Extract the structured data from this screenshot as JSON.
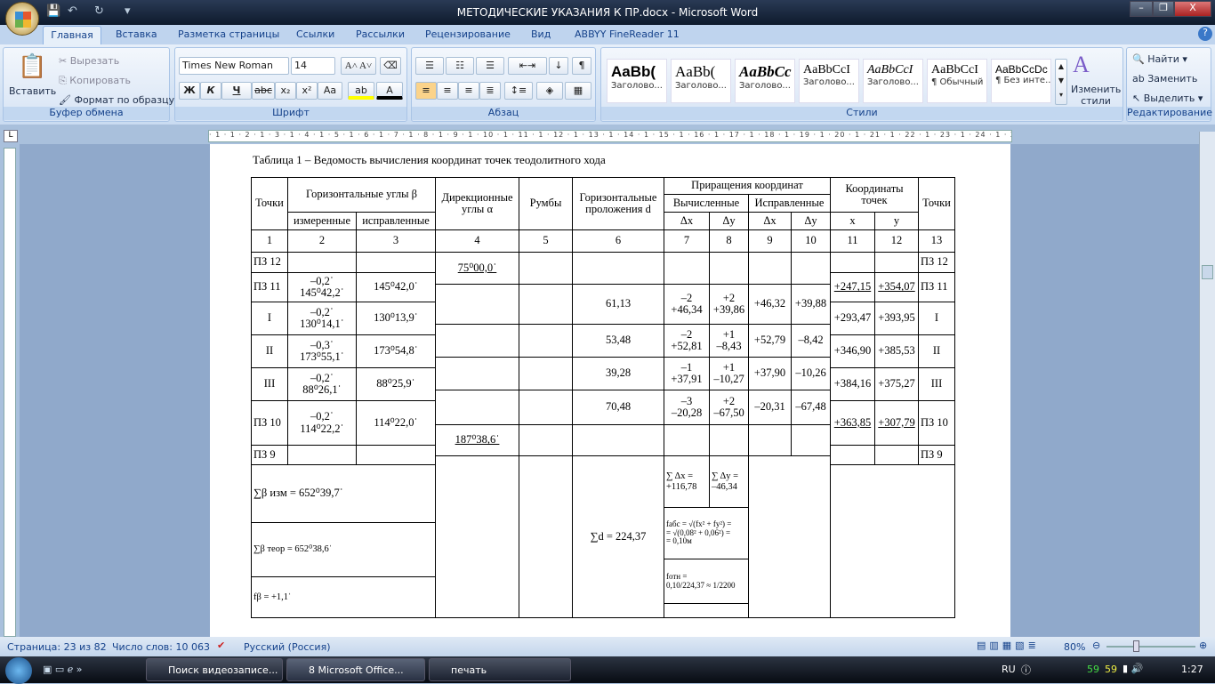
{
  "window": {
    "title": "МЕТОДИЧЕСКИЕ УКАЗАНИЯ К ПР.docx - Microsoft Word",
    "minimize": "–",
    "restore": "❐",
    "close": "X"
  },
  "tabs": [
    "Главная",
    "Вставка",
    "Разметка страницы",
    "Ссылки",
    "Рассылки",
    "Рецензирование",
    "Вид",
    "ABBYY FineReader 11"
  ],
  "clipboard": {
    "paste": "Вставить",
    "cut": "Вырезать",
    "copy": "Копировать",
    "format_painter": "Формат по образцу",
    "label": "Буфер обмена"
  },
  "font": {
    "name": "Times New Roman",
    "size": "14",
    "label": "Шрифт",
    "bold": "Ж",
    "italic": "К",
    "underline": "Ч",
    "strike": "abc",
    "sub": "x₂",
    "sup": "x²",
    "case": "Aa"
  },
  "paragraph": {
    "label": "Абзац"
  },
  "styles": {
    "label": "Стили",
    "items": [
      {
        "sample": "AaBb(",
        "name": "Заголово..."
      },
      {
        "sample": "AaBb(",
        "name": "Заголово..."
      },
      {
        "sample": "AaBbCc",
        "name": "Заголово..."
      },
      {
        "sample": "AaBbCcI",
        "name": "Заголово..."
      },
      {
        "sample": "AaBbCcI",
        "name": "Заголово..."
      },
      {
        "sample": "AaBbCcI",
        "name": "¶ Обычный"
      },
      {
        "sample": "AaBbCcDc",
        "name": "¶ Без инте..."
      }
    ],
    "change": "Изменить стили"
  },
  "editing": {
    "label": "Редактирование",
    "find": "Найти",
    "replace": "Заменить",
    "select": "Выделить"
  },
  "ruler": "· 1 · 1 · 2 · 1 · 3 · 1 · 4 · 1 · 5 · 1 · 6 · 1 · 7 · 1 · 8 · 1 · 9 · 1 · 10 · 1 · 11 · 1 · 12 · 1 · 13 · 1 · 14 · 1 · 15 · 1 · 16 · 1 · 17 · 1 · 18 · 1 · 19 · 1 · 20 · 1 · 21 · 1 · 22 · 1 · 23 · 1 · 24 · 1 · 25 · 1 · 26 · 1 · 27 · 1 · 28",
  "doc": {
    "caption": "Таблица 1 – Ведомость вычисления координат точек теодолитного хода",
    "headers": {
      "points": "Точки",
      "hangles": "Горизонтальные углы β",
      "measured": "измеренные",
      "corrected": "исправленные",
      "dir": "Дирекционные\nуглы α",
      "rumb": "Румбы",
      "hdist": "Горизонтальные проложения d",
      "incr": "Приращения координат",
      "calc": "Вычисленные",
      "corr": "Исправленные",
      "dx": "Δx",
      "dy": "Δy",
      "coords": "Координаты\nточек",
      "x": "x",
      "y": "y",
      "points2": "Точки"
    },
    "colnums": [
      "1",
      "2",
      "3",
      "4",
      "5",
      "6",
      "7",
      "8",
      "9",
      "10",
      "11",
      "12",
      "13"
    ],
    "points": [
      "ПЗ 12",
      "ПЗ 11",
      "I",
      "II",
      "III",
      "ПЗ 10",
      "ПЗ 9"
    ],
    "measured": [
      "",
      "–0,2ˈ\n145⁰42,2ˈ",
      "–0,2ˈ\n130⁰14,1ˈ",
      "–0,3ˈ\n173⁰55,1ˈ",
      "–0,2ˈ\n88⁰26,1ˈ",
      "–0,2ˈ\n114⁰22,2ˈ",
      ""
    ],
    "corrected": [
      "",
      "145⁰42,0ˈ",
      "130⁰13,9ˈ",
      "173⁰54,8ˈ",
      "88⁰25,9ˈ",
      "114⁰22,0ˈ",
      ""
    ],
    "dir_start": "75⁰00,0ˈ",
    "dir_end": "187⁰38,6ˈ",
    "legs": [
      {
        "d": "61,13",
        "dx": "–2\n+46,34",
        "dy": "+2\n+39,86",
        "dxc": "+46,32",
        "dyc": "+39,88"
      },
      {
        "d": "53,48",
        "dx": "–2\n+52,81",
        "dy": "+1\n–8,43",
        "dxc": "+52,79",
        "dyc": "–8,42"
      },
      {
        "d": "39,28",
        "dx": "–1\n+37,91",
        "dy": "+1\n–10,27",
        "dxc": "+37,90",
        "dyc": "–10,26"
      },
      {
        "d": "70,48",
        "dx": "–3\n–20,28",
        "dy": "+2\n–67,50",
        "dxc": "–20,31",
        "dyc": "–67,48"
      }
    ],
    "coords": [
      {
        "x": "",
        "y": ""
      },
      {
        "x": "+247,15",
        "y": "+354,07"
      },
      {
        "x": "+293,47",
        "y": "+393,95"
      },
      {
        "x": "+346,90",
        "y": "+385,53"
      },
      {
        "x": "+384,16",
        "y": "+375,27"
      },
      {
        "x": "+363,85",
        "y": "+307,79"
      },
      {
        "x": "",
        "y": ""
      }
    ],
    "sum_meas": "∑β изм = 652⁰39,7ˈ",
    "sum_theor": "∑β теор = 652⁰38,6ˈ",
    "f_beta": "fβ = +1,1ˈ",
    "sum_d": "∑d = 224,37",
    "sum_dx": "∑ Δx =\n+116,78",
    "sum_dy": "∑ Δy =\n–46,34",
    "f_abs": "fабс = √(fx² + fy²) =\n= √(0,08² + 0,06²) =\n= 0,10м",
    "f_rel": "fотн =\n0,10/224,37 ≈ 1/2200"
  },
  "status": {
    "page": "Страница: 23 из 82",
    "words": "Число слов: 10 063",
    "lang": "Русский (Россия)",
    "zoom": "80%",
    "zoom_value": 80
  },
  "taskbar": {
    "items": [
      "Поиск видеозаписе...",
      "8 Microsoft Office...",
      "печать"
    ],
    "lang": "RU",
    "tray1": "59",
    "tray2": "59",
    "time": "1:27"
  }
}
